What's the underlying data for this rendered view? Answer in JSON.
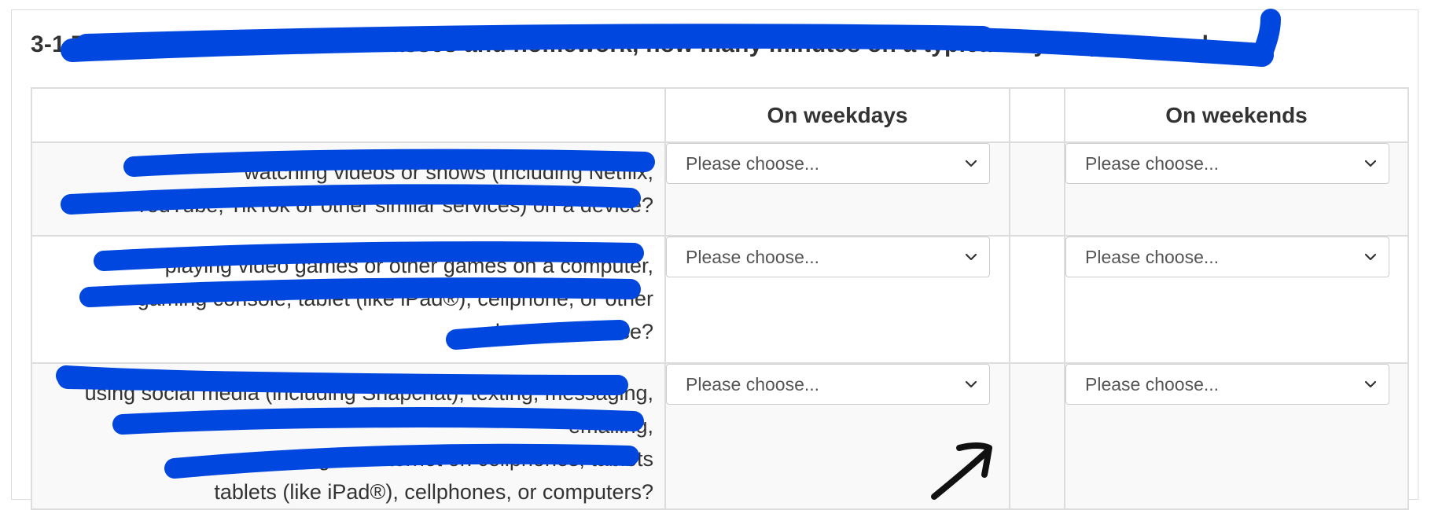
{
  "question": {
    "title": "3-1 Thinking about outside of classes and homework, how many minutes on a typical day do you spend..."
  },
  "table": {
    "headers": {
      "label": "",
      "weekdays": "On weekdays",
      "gap": "",
      "weekends": "On weekends"
    },
    "rows": [
      {
        "text_lines": [
          "watching videos or shows (including Netflix,",
          "YouTube, TikTok or other similar services) on a device?"
        ],
        "weekday_value": "Please choose...",
        "weekend_value": "Please choose..."
      },
      {
        "text_lines": [
          "playing video games or other games on a computer,",
          "gaming console, tablet (like iPad®), cellphone, or other",
          "electronic device?"
        ],
        "weekday_value": "Please choose...",
        "weekend_value": "Please choose..."
      },
      {
        "text_lines": [
          "using social media (including Snapchat), texting, messaging, emailing,",
          "surfing the internet on cellphones, tablets",
          "tablets (like iPad®), cellphones, or computers?"
        ],
        "weekday_value": "Please choose...",
        "weekend_value": "Please choose..."
      }
    ]
  },
  "icons": {
    "dropdown": "chevron-down-icon",
    "annotation": "arrow-annotation"
  },
  "colors": {
    "redaction": "#0047e0",
    "border": "#dddddd",
    "text": "#333333",
    "stripe": "#f9f9f9"
  }
}
